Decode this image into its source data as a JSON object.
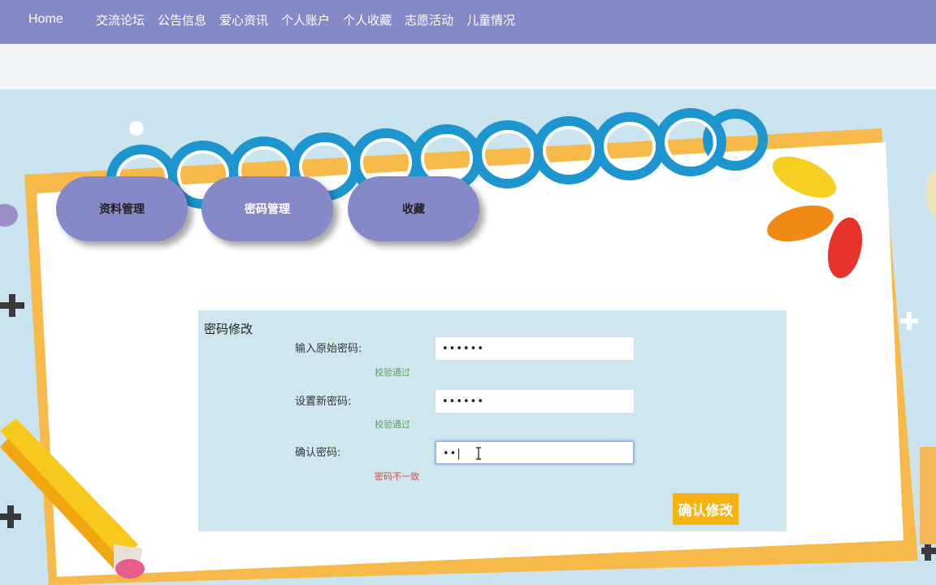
{
  "nav": {
    "home": "Home",
    "items": [
      "交流论坛",
      "公告信息",
      "爱心资讯",
      "个人账户",
      "个人收藏",
      "志愿活动",
      "儿童情况"
    ]
  },
  "tabs": [
    "资料管理",
    "密码管理",
    "收藏"
  ],
  "form": {
    "title": "密码修改",
    "fields": [
      {
        "label": "输入原始密码:",
        "value": "••••••",
        "hint": "校验通过",
        "status": "ok"
      },
      {
        "label": "设置新密码:",
        "value": "••••••",
        "hint": "校验通过",
        "status": "ok"
      },
      {
        "label": "确认密码:",
        "value": "••|",
        "hint": "密码不一致",
        "status": "error"
      }
    ],
    "submit": "确认修改"
  },
  "colors": {
    "nav_bg": "#8589c8",
    "tab_bg": "#8589c8",
    "button": "#f7b313",
    "ok": "#5aa35a",
    "error": "#d64a4a"
  }
}
